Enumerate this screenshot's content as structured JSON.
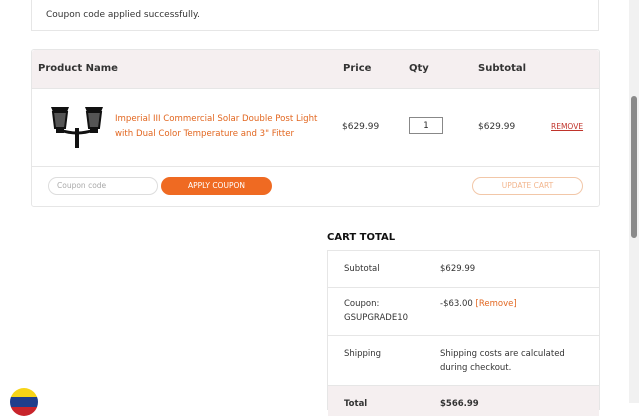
{
  "notice": "Coupon code applied successfully.",
  "table": {
    "headers": [
      "Product Name",
      "Price",
      "Qty",
      "Subtotal"
    ],
    "item": {
      "name": "Imperial III Commercial Solar Double Post Light with Dual Color Temperature and 3\" Fitter",
      "price": "$629.99",
      "qty": "1",
      "subtotal": "$629.99",
      "remove": "REMOVE"
    }
  },
  "coupon": {
    "placeholder": "Coupon code",
    "apply": "APPLY COUPON",
    "update": "UPDATE CART"
  },
  "totals": {
    "title": "CART TOTAL",
    "subtotal_label": "Subtotal",
    "subtotal_value": "$629.99",
    "coupon_label": "Coupon:",
    "coupon_code": "GSUPGRADE10",
    "coupon_value": "-$63.00",
    "coupon_remove": "[Remove]",
    "shipping_label": "Shipping",
    "shipping_value": "Shipping costs are calculated during checkout.",
    "total_label": "Total",
    "total_value": "$566.99"
  },
  "colors": {
    "accent": "#ef6a22",
    "header_bg": "#f5eff0",
    "remove": "#c0342b"
  }
}
